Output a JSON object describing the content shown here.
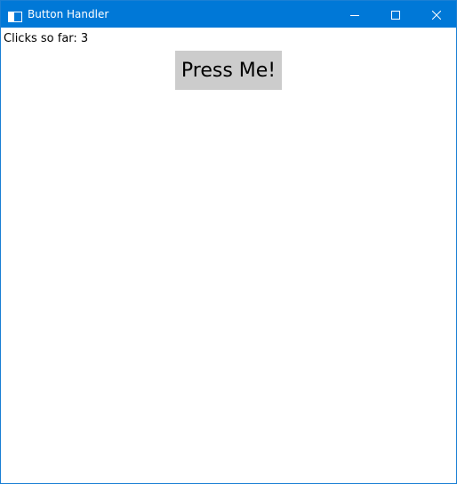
{
  "window": {
    "title": "Button Handler",
    "title_icon": "app-window-icon",
    "controls": {
      "minimize_icon": "minimize-icon",
      "maximize_icon": "maximize-icon",
      "close_icon": "close-icon"
    },
    "colors": {
      "titlebar": "#0078d7",
      "title_text": "#ffffff",
      "button_bg": "#cccccc"
    }
  },
  "content": {
    "clicks_label": "Clicks so far: 3",
    "button_label": "Press Me!"
  }
}
